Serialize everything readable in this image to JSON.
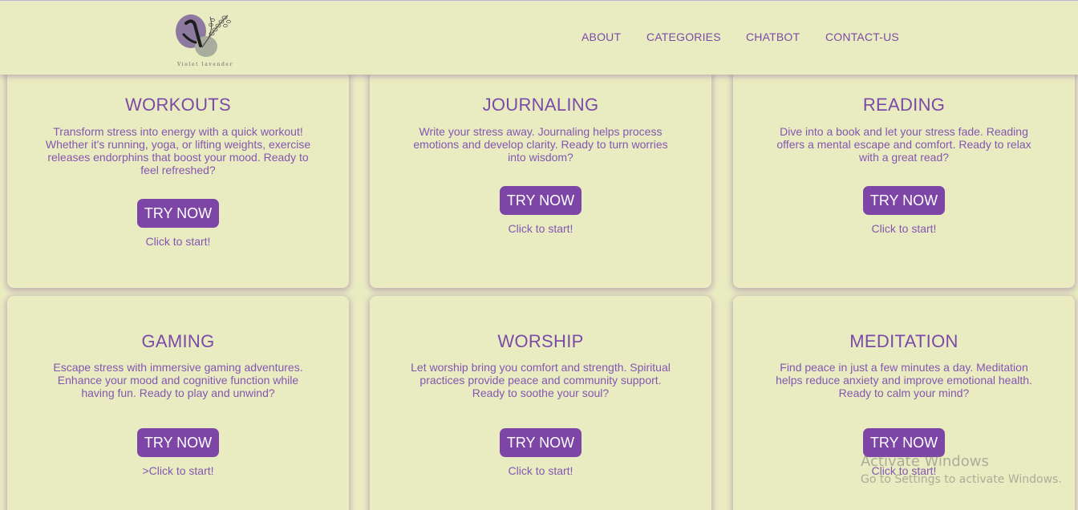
{
  "header": {
    "logo_text": "Violet lavender",
    "nav": [
      {
        "label": "ABOUT"
      },
      {
        "label": "CATEGORIES"
      },
      {
        "label": "CHATBOT"
      },
      {
        "label": "CONTACT-US"
      }
    ]
  },
  "cards": [
    {
      "title": "WORKOUTS",
      "description": "Transform stress into energy with a quick workout! Whether it's running, yoga, or lifting weights, exercise releases endorphins that boost your mood. Ready to feel refreshed?",
      "button": "TRY NOW",
      "hint": "Click to start!"
    },
    {
      "title": "JOURNALING",
      "description": "Write your stress away. Journaling helps process emotions and develop clarity. Ready to turn worries into wisdom?",
      "button": "TRY NOW",
      "hint": "Click to start!"
    },
    {
      "title": "READING",
      "description": "Dive into a book and let your stress fade. Reading offers a mental escape and comfort. Ready to relax with a great read?",
      "button": "TRY NOW",
      "hint": "Click to start!"
    },
    {
      "title": "GAMING",
      "description": "Escape stress with immersive gaming adventures. Enhance your mood and cognitive function while having fun. Ready to play and unwind?",
      "button": "TRY NOW",
      "hint": ">Click to start!"
    },
    {
      "title": "WORSHIP",
      "description": "Let worship bring you comfort and strength. Spiritual practices provide peace and community support. Ready to soothe your soul?",
      "button": "TRY NOW",
      "hint": "Click to start!"
    },
    {
      "title": "MEDITATION",
      "description": "Find peace in just a few minutes a day. Meditation helps reduce anxiety and improve emotional health. Ready to calm your mind?",
      "button": "TRY NOW",
      "hint": "Click to start!"
    }
  ],
  "watermark": {
    "line1": "Activate Windows",
    "line2": "Go to Settings to activate Windows."
  },
  "colors": {
    "background": "#e9ecc0",
    "accent": "#7d45a6",
    "text": "#7b4aa8"
  }
}
